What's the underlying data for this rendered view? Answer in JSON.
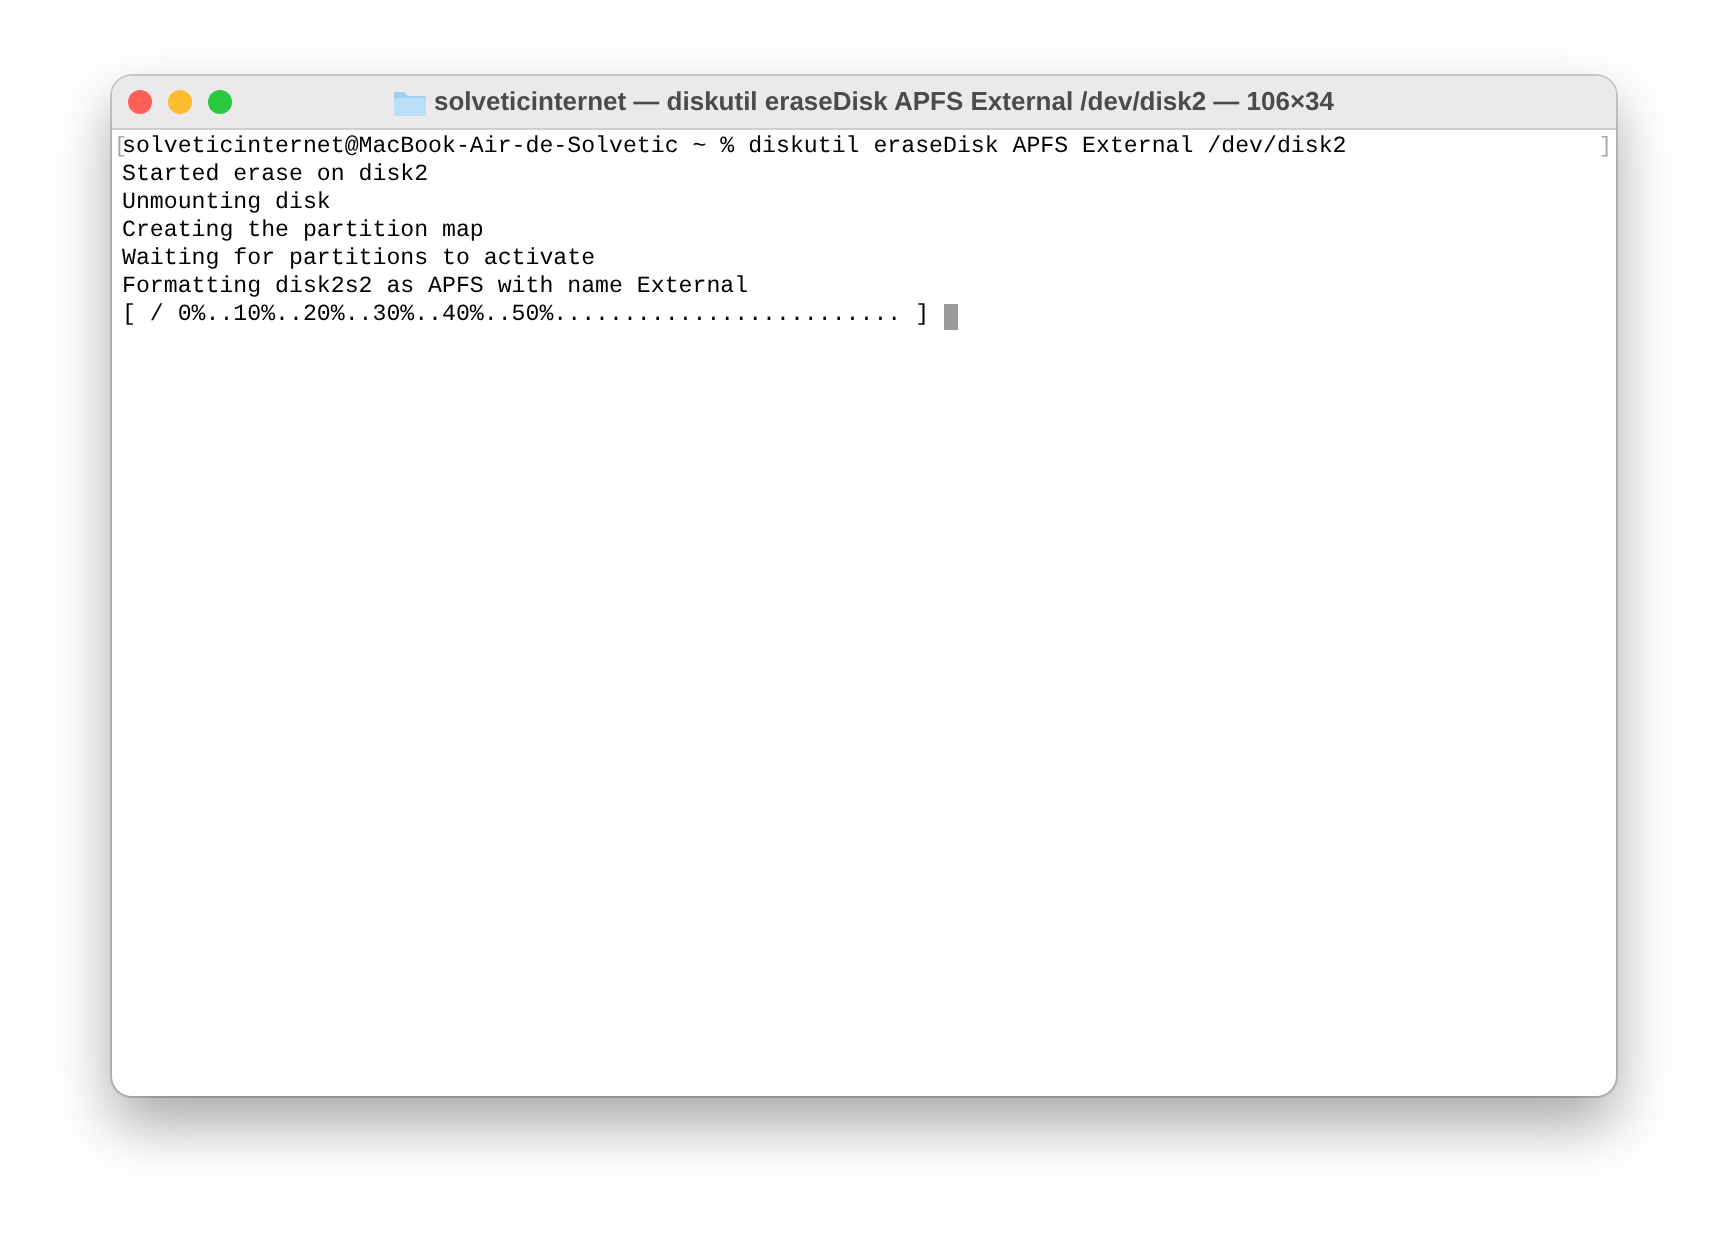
{
  "window": {
    "title": "solveticinternet — diskutil eraseDisk APFS External /dev/disk2 — 106×34"
  },
  "terminal": {
    "marked_line": {
      "left_mark": "[",
      "right_mark": "]"
    },
    "lines": [
      "solveticinternet@MacBook-Air-de-Solvetic ~ % diskutil eraseDisk APFS External /dev/disk2",
      "Started erase on disk2",
      "Unmounting disk",
      "Creating the partition map",
      "Waiting for partitions to activate",
      "Formatting disk2s2 as APFS with name External",
      "[ / 0%..10%..20%..30%..40%..50%......................... ]"
    ],
    "cursor": {
      "visible": true
    }
  }
}
